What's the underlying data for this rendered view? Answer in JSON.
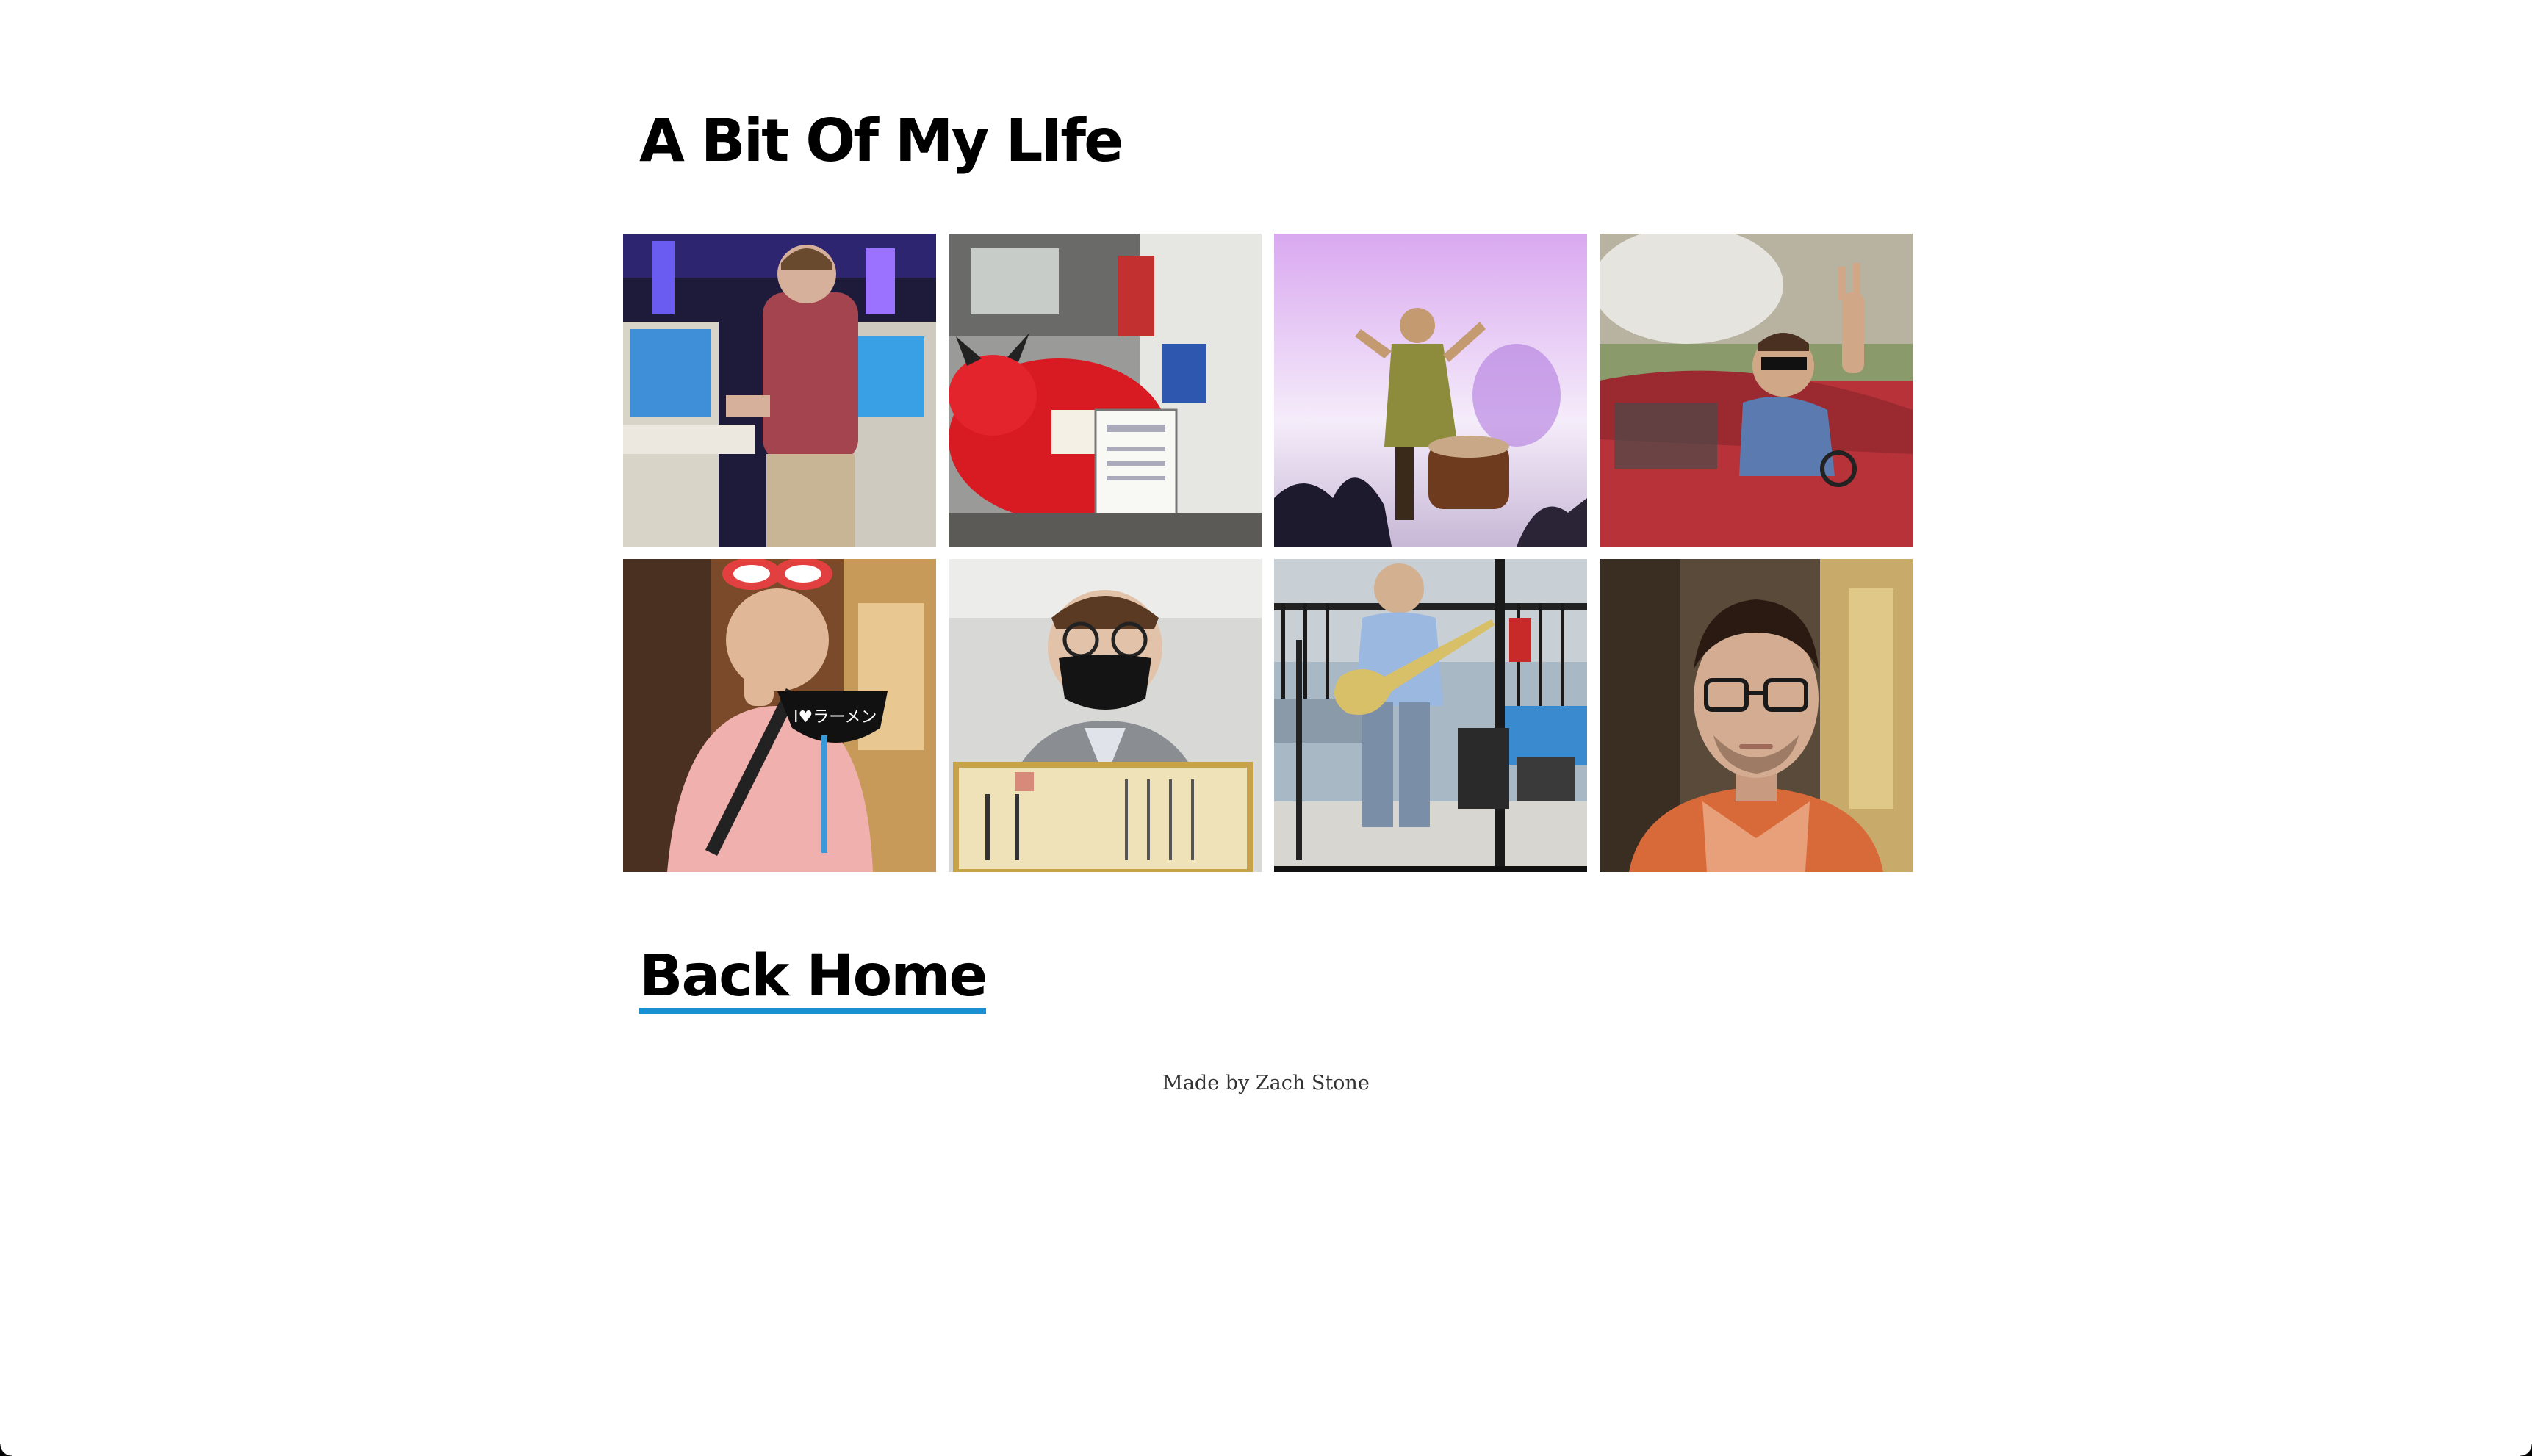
{
  "page": {
    "title": "A Bit Of My LIfe",
    "back_home_label": "Back Home",
    "footer_text": "Made by Zach Stone"
  },
  "gallery": {
    "photos": [
      {
        "name": "photo-arcade-rhythm-game"
      },
      {
        "name": "photo-red-akabeko-cow-statue"
      },
      {
        "name": "photo-taiko-drummer-on-stage"
      },
      {
        "name": "photo-convertible-car-peace-sign"
      },
      {
        "name": "photo-ramen-sign-mustache-mask"
      },
      {
        "name": "photo-masked-man-with-certificate"
      },
      {
        "name": "photo-bass-guitar-performance"
      },
      {
        "name": "photo-selfie-with-glasses"
      }
    ]
  },
  "colors": {
    "link_underline": "#1a8fd1",
    "text": "#000000",
    "footer_text": "#333333",
    "background": "#ffffff"
  }
}
